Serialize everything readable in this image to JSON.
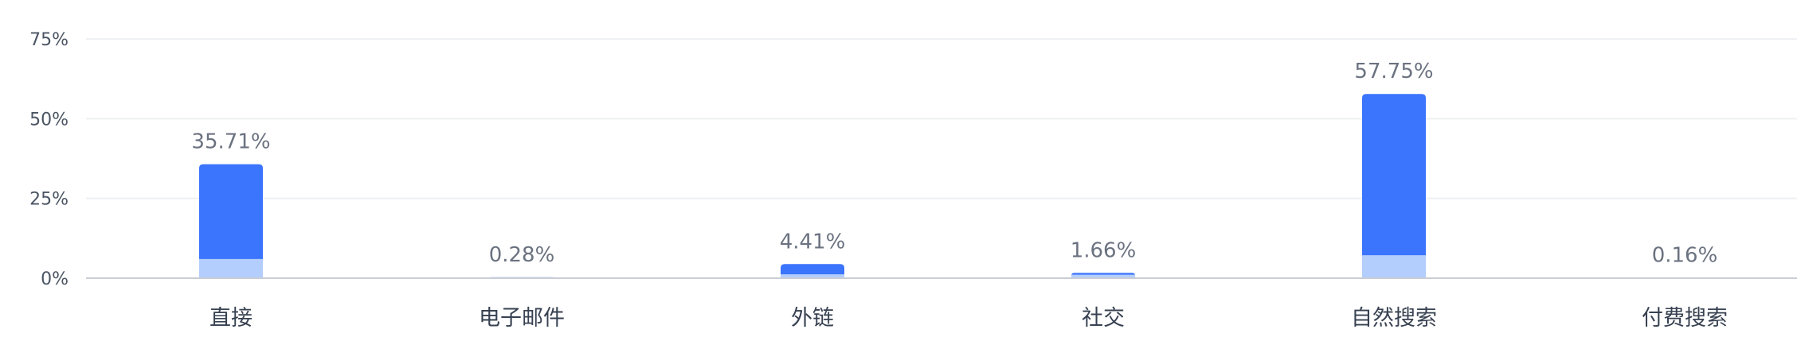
{
  "chart_data": {
    "type": "bar",
    "categories": [
      "直接",
      "电子邮件",
      "外链",
      "社交",
      "自然搜索",
      "付费搜索"
    ],
    "series": [
      {
        "values": [
          35.71,
          0.28,
          4.41,
          1.66,
          57.75,
          0.16
        ],
        "color": "#3b74fd"
      },
      {
        "values": [
          6.0,
          0.28,
          1.2,
          1.1,
          7.2,
          0.16
        ],
        "color": "#b3cdfc"
      }
    ],
    "data_labels": [
      "35.71%",
      "0.28%",
      "4.41%",
      "1.66%",
      "57.75%",
      "0.16%"
    ],
    "y_ticks": [
      "0%",
      "25%",
      "50%",
      "75%"
    ],
    "ylim": [
      0,
      75
    ],
    "grid": true,
    "legend": "none"
  }
}
